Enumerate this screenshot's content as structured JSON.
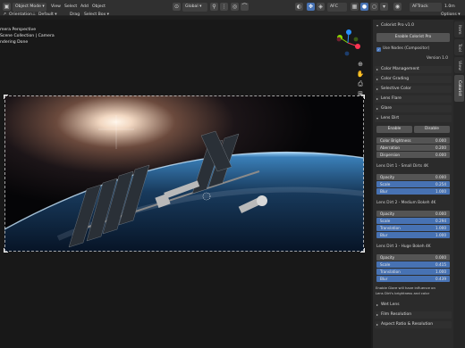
{
  "header": {
    "mode_label": "Object Mode",
    "menu": [
      "View",
      "Select",
      "Add",
      "Object"
    ],
    "orientation_label": "Global",
    "render_engine_label": "AFC",
    "tracking_label": "AFTrack",
    "zoom_value": "1.0m"
  },
  "toolbar": {
    "orientation_label": "Orientation",
    "default_label": "Default",
    "drag_label": "Drag",
    "select_box_label": "Select Box",
    "options_label": "Options"
  },
  "viewport": {
    "line1": "mera Perspective",
    "line2": "Scene Collection | Camera",
    "line3": "ndering Done"
  },
  "side_tabs": [
    "Item",
    "Tool",
    "View",
    "Colorist"
  ],
  "panel": {
    "main_header": "Colorist Pro v1.0",
    "enable_button": "Enable Colorist Pro",
    "use_nodes_label": "Use Nodes (Compositor)",
    "version_text": "Version 1.0",
    "sections": [
      "Color Management",
      "Color Grading",
      "Selective Color",
      "Lens Flare",
      "Glare",
      "Lens Dirt"
    ],
    "dirt_buttons": [
      "Enable",
      "Disable"
    ],
    "dirt_fields": [
      {
        "label": "Color Brightness",
        "value": "0.000"
      },
      {
        "label": "Aberration",
        "value": "0.200"
      },
      {
        "label": "Dispersion",
        "value": "0.000"
      }
    ],
    "dirt_groups": [
      {
        "title": "Lens Dirt 1 - Small Dirts 4K",
        "fields": [
          {
            "label": "Opacity",
            "value": "0.000",
            "style": "plain"
          },
          {
            "label": "Scale",
            "value": "0.254",
            "style": "blue"
          },
          {
            "label": "Blur",
            "value": "1.000",
            "style": "blue"
          }
        ]
      },
      {
        "title": "Lens Dirt 2 - Medium Bokeh 4K",
        "fields": [
          {
            "label": "Opacity",
            "value": "0.000",
            "style": "plain"
          },
          {
            "label": "Scale",
            "value": "0.294",
            "style": "blue"
          },
          {
            "label": "Translation",
            "value": "1.000",
            "style": "blue"
          },
          {
            "label": "Blur",
            "value": "1.000",
            "style": "blue"
          }
        ]
      },
      {
        "title": "Lens Dirt 3 - Huge Bokeh 4K",
        "fields": [
          {
            "label": "Opacity",
            "value": "0.000",
            "style": "plain"
          },
          {
            "label": "Scale",
            "value": "0.415",
            "style": "blue"
          },
          {
            "label": "Translation",
            "value": "1.000",
            "style": "blue"
          },
          {
            "label": "Blur",
            "value": "0.439",
            "style": "blue"
          }
        ]
      }
    ],
    "note_line1": "Enable Glare will have influence on",
    "note_line2": "Lens Dirt's brightness and color",
    "wet_lens": "Wet Lens",
    "bottom_sections": [
      "Film Resolution",
      "Aspect Ratio & Resolution"
    ]
  },
  "colors": {
    "accent": "#4772b3",
    "panel_bg": "#2b2b2b",
    "header_bg": "#303030"
  }
}
